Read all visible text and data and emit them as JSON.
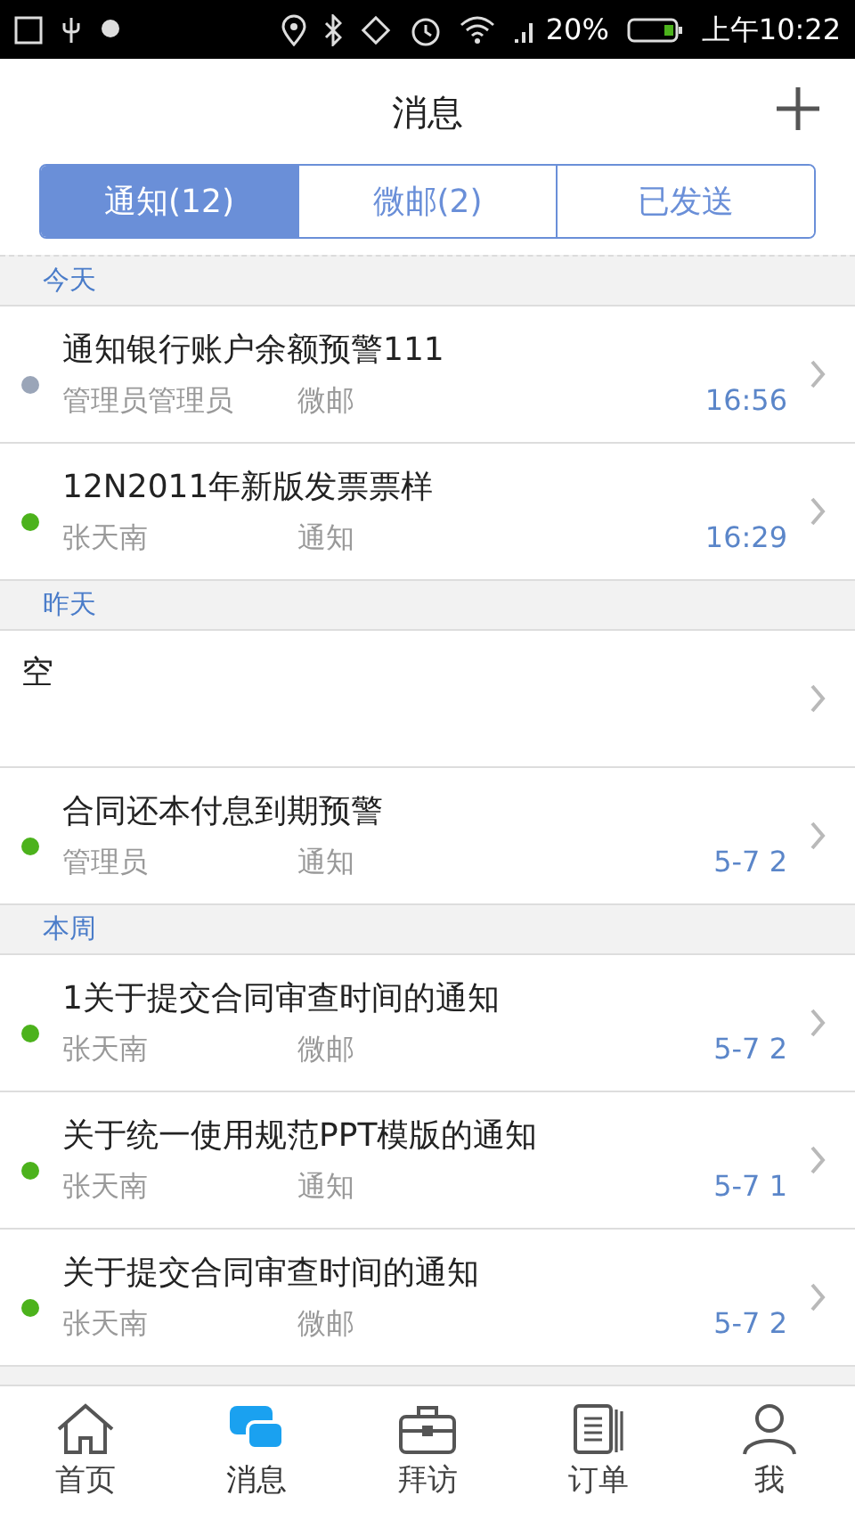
{
  "status_bar": {
    "battery": "20%",
    "time": "上午10:22"
  },
  "header": {
    "title": "消息"
  },
  "tabs": [
    {
      "label": "通知(12)",
      "selected": true
    },
    {
      "label": "微邮(2)",
      "selected": false
    },
    {
      "label": "已发送",
      "selected": false
    }
  ],
  "sections": [
    {
      "title": "今天",
      "items": [
        {
          "kind": "message",
          "title": "通知银行账户余额预警111",
          "sender": "管理员管理员",
          "type": "微邮",
          "time": "16:56",
          "color": "#9aa5b8"
        },
        {
          "kind": "message",
          "title": "12N2011年新版发票票样",
          "sender": "张天南",
          "type": "通知",
          "time": "16:29",
          "color": "#4cb21c"
        }
      ]
    },
    {
      "title": "昨天",
      "items": [
        {
          "kind": "empty",
          "title": "空"
        },
        {
          "kind": "message",
          "title": "合同还本付息到期预警",
          "sender": "管理员",
          "type": "通知",
          "time": "5-7 2",
          "color": "#4cb21c"
        }
      ]
    },
    {
      "title": "本周",
      "items": [
        {
          "kind": "message",
          "title": "1关于提交合同审查时间的通知",
          "sender": "张天南",
          "type": "微邮",
          "time": "5-7 2",
          "color": "#4cb21c"
        },
        {
          "kind": "message",
          "title": "关于统一使用规范PPT模版的通知",
          "sender": "张天南",
          "type": "通知",
          "time": "5-7 1",
          "color": "#4cb21c"
        },
        {
          "kind": "message",
          "title": "关于提交合同审查时间的通知",
          "sender": "张天南",
          "type": "微邮",
          "time": "5-7 2",
          "color": "#4cb21c"
        }
      ]
    }
  ],
  "bottom_nav": [
    {
      "label": "首页",
      "kind": "home",
      "selected": false
    },
    {
      "label": "消息",
      "kind": "chat",
      "selected": true
    },
    {
      "label": "拜访",
      "kind": "briefcase",
      "selected": false
    },
    {
      "label": "订单",
      "kind": "document",
      "selected": false
    },
    {
      "label": "我",
      "kind": "person",
      "selected": false
    }
  ]
}
